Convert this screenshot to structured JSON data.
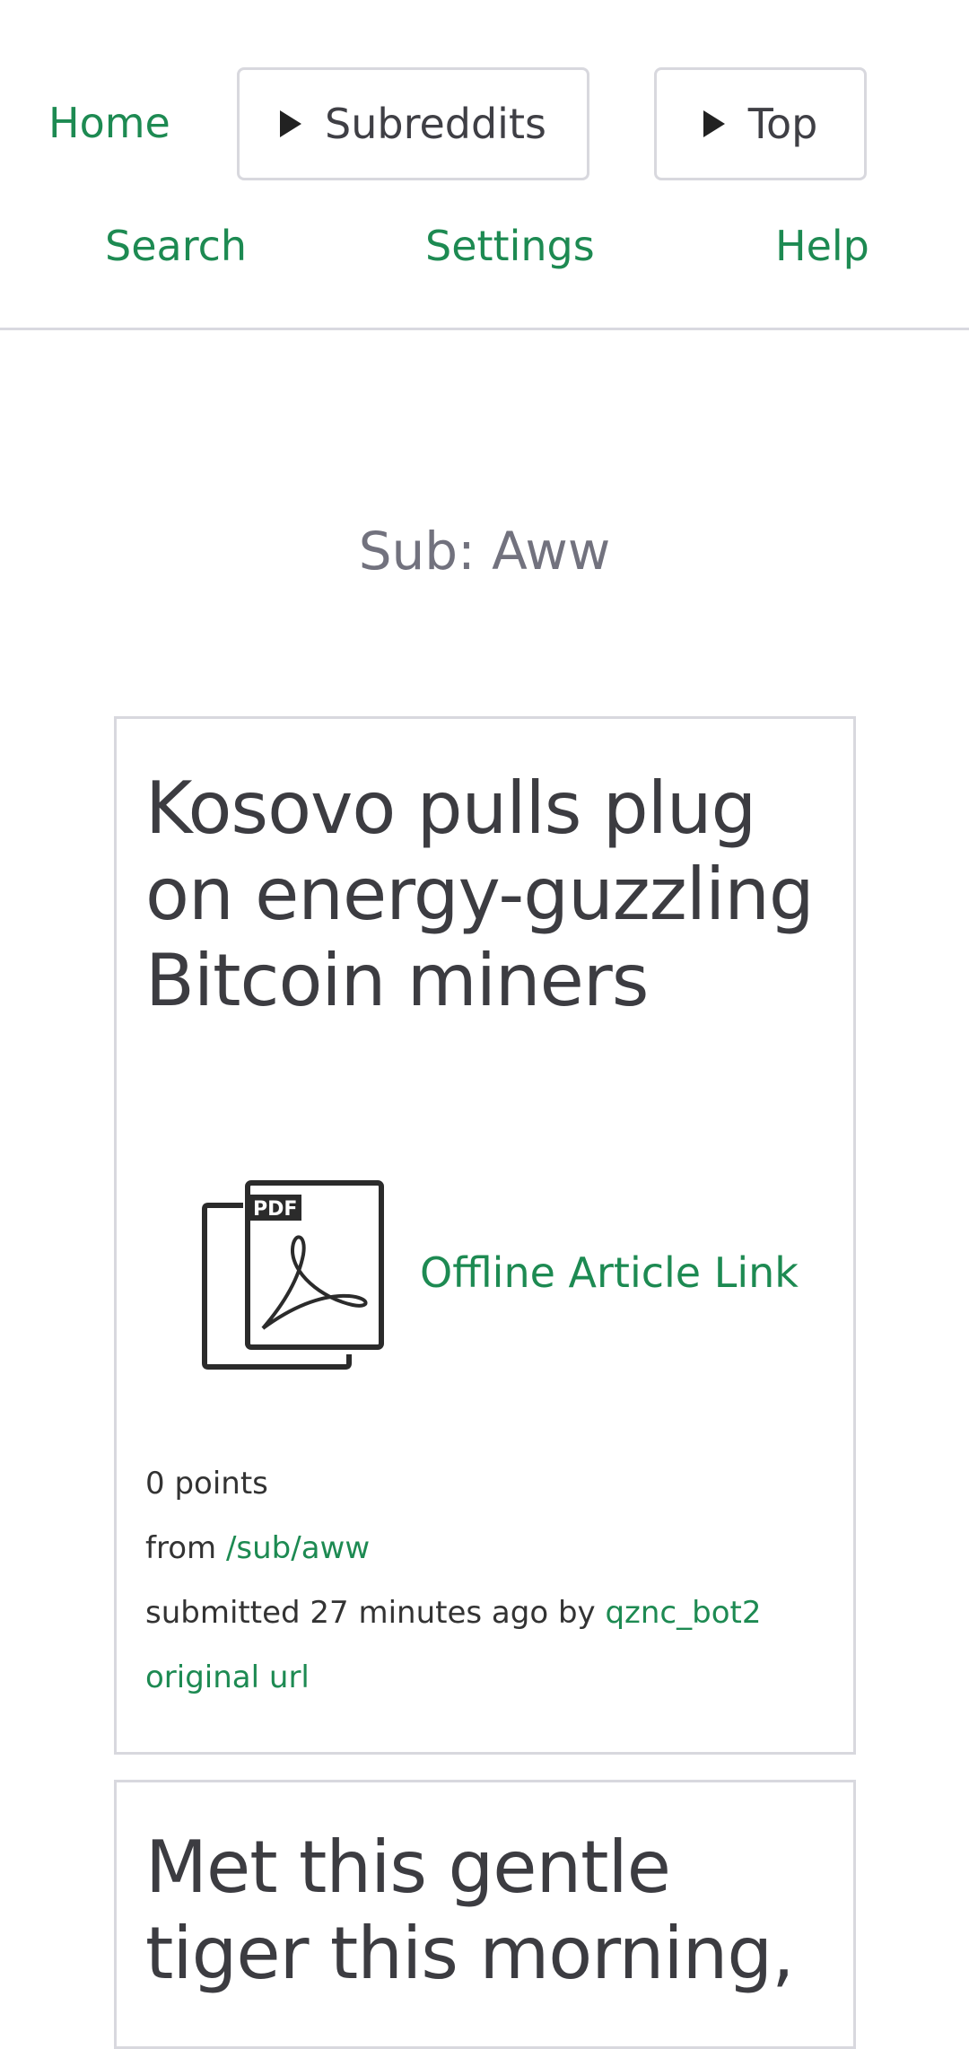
{
  "nav": {
    "home": "Home",
    "subreddits": "Subreddits",
    "top": "Top",
    "search": "Search",
    "settings": "Settings",
    "help": "Help"
  },
  "page": {
    "sub_title": "Sub: Aww"
  },
  "posts": [
    {
      "title": "Kosovo pulls plug on energy-guzzling Bitcoin miners",
      "thumbnail_icon": "pdf-document-icon",
      "offline_link": "Offline Article Link",
      "points": "0 points",
      "from_label": "from",
      "sub_link": "/sub/aww",
      "submitted_label": "submitted",
      "time_ago": "27 minutes ago",
      "by_label": "by",
      "author": "qznc_bot2",
      "original_url_label": "original url"
    },
    {
      "title": "Met this gentle tiger this morning,"
    }
  ],
  "colors": {
    "link": "#1d8a52",
    "title_text": "#3c3c41",
    "muted_text": "#72727e",
    "border": "#d8d8de"
  }
}
